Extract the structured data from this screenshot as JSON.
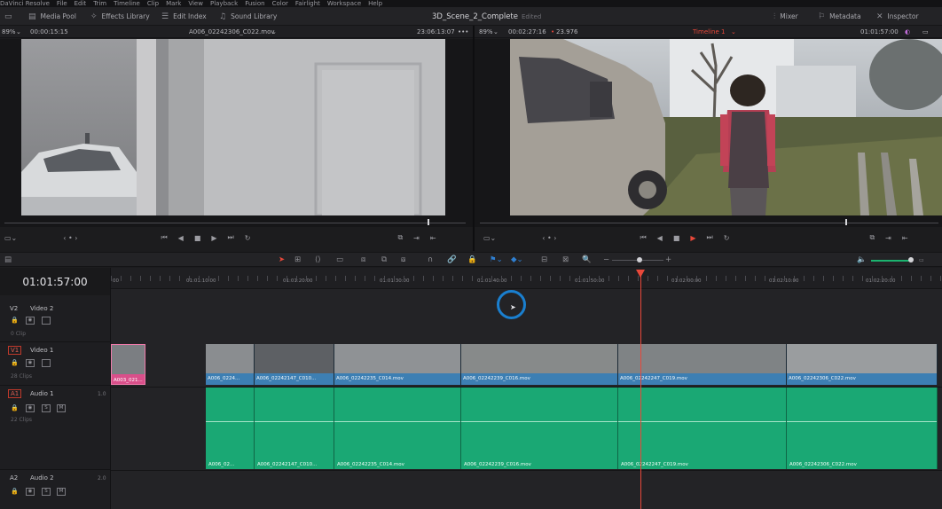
{
  "menu": [
    "DaVinci Resolve",
    "File",
    "Edit",
    "Trim",
    "Timeline",
    "Clip",
    "Mark",
    "View",
    "Playback",
    "Fusion",
    "Color",
    "Fairlight",
    "Workspace",
    "Help"
  ],
  "toolbar": {
    "media_pool": "Media Pool",
    "effects_library": "Effects Library",
    "edit_index": "Edit Index",
    "sound_library": "Sound Library",
    "project_title": "3D_Scene_2_Complete",
    "edited": "Edited",
    "mixer": "Mixer",
    "metadata": "Metadata",
    "inspector": "Inspector"
  },
  "source_viewer": {
    "zoom": "89%",
    "duration": "00:00:15:15",
    "clip_name": "A006_02242306_C022.mov",
    "timecode": "23:06:13:07"
  },
  "timeline_viewer": {
    "zoom": "89%",
    "duration": "00:02:27:16",
    "fps": "23.976",
    "timeline_name": "Timeline 1",
    "timecode": "01:01:57:00"
  },
  "timeline": {
    "timecode": "01:01:57:00",
    "ruler": [
      "00",
      "01:01:10:00",
      "01:01:20:00",
      "01:01:30:00",
      "01:01:40:00",
      "01:01:50:00",
      "01:02:00:00",
      "01:02:10:00",
      "01:02:20:00"
    ],
    "tracks": {
      "v2": {
        "id": "V2",
        "name": "Video 2",
        "count": "0 Clip"
      },
      "v1": {
        "id": "V1",
        "name": "Video 1",
        "count": "28 Clips"
      },
      "a1": {
        "id": "A1",
        "name": "Audio 1",
        "level": "1.0",
        "count": "22 Clips"
      },
      "a2": {
        "id": "A2",
        "name": "Audio 2",
        "level": "2.0"
      }
    },
    "pink_clip": "A003_021...",
    "video_clips": [
      "A006_0224...",
      "A006_02242147_C010...",
      "A006_02242235_C014.mov",
      "A006_02242239_C016.mov",
      "A006_02242247_C019.mov",
      "A006_02242306_C022.mov"
    ],
    "audio_clips": [
      "A006_02...",
      "A006_02242147_C010...",
      "A006_02242235_C014.mov",
      "A006_02242239_C016.mov",
      "A006_02242247_C019.mov",
      "A006_02242306_C022.mov"
    ]
  },
  "icons": [
    "media-pool-icon",
    "effects-icon",
    "edit-index-icon",
    "sound-library-icon",
    "mixer-icon",
    "metadata-icon",
    "inspector-icon",
    "lock-icon",
    "eye-icon",
    "link-icon",
    "razor-icon"
  ]
}
